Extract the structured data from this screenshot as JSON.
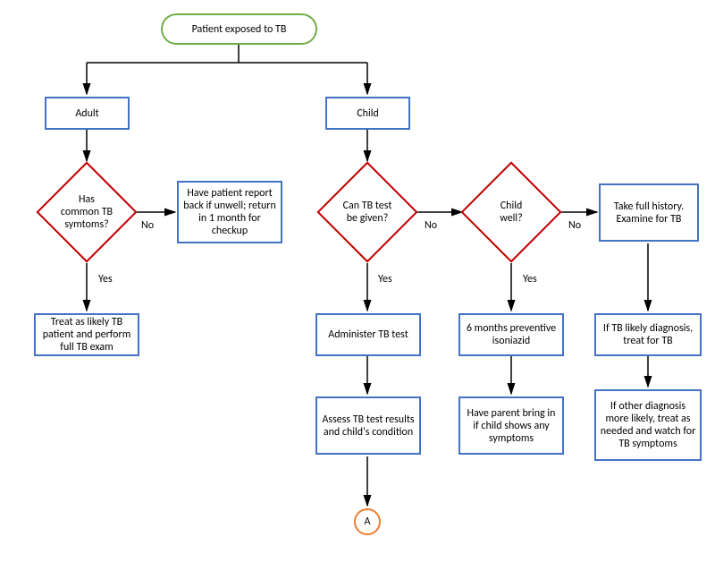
{
  "nodes": {
    "start": "Patient exposed to TB",
    "adult": "Adult",
    "child": "Child",
    "has_symptoms": "Has common TB symtoms?",
    "report_back": "Have patient report back if unwell; return in 1 month for checkup",
    "treat_adult": "Treat as likely TB patient and perform full TB exam",
    "can_test": "Can TB test be given?",
    "child_well": "Child well?",
    "full_history": "Take full history. Examine for TB",
    "administer": "Administer TB test",
    "isoniazid": "6 months preventive isoniazid",
    "treat_tb": "If TB likely diagnosis, treat for TB",
    "assess": "Assess TB test results and child's condition",
    "parent_bring": "Have parent bring in if child shows any symptoms",
    "other_diag": "If other diagnosis more likely, treat as needed and watch for TB symptoms",
    "connector_a": "A"
  },
  "labels": {
    "yes": "Yes",
    "no": "No"
  }
}
